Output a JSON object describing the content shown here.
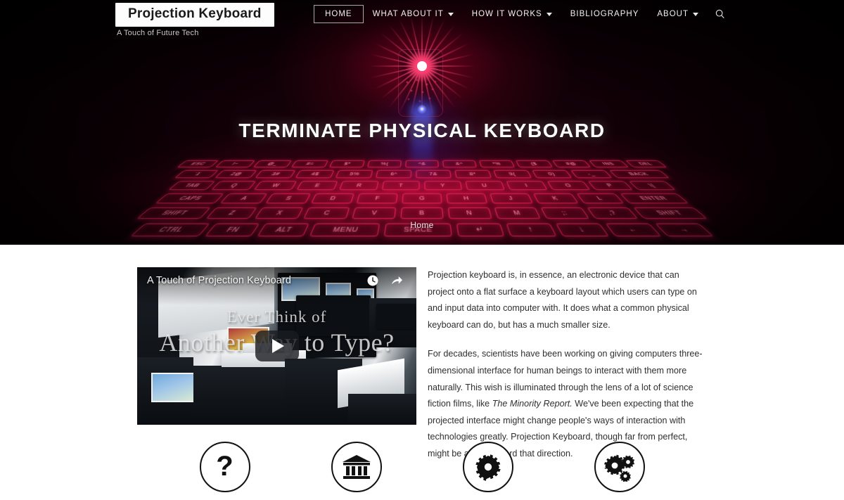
{
  "site": {
    "logo": "Projection Keyboard",
    "tagline": "A Touch of Future Tech"
  },
  "nav": {
    "items": [
      {
        "label": "HOME",
        "active": true,
        "has_dropdown": false
      },
      {
        "label": "WHAT ABOUT IT",
        "active": false,
        "has_dropdown": true
      },
      {
        "label": "HOW IT WORKS",
        "active": false,
        "has_dropdown": true
      },
      {
        "label": "BIBLIOGRAPHY",
        "active": false,
        "has_dropdown": false
      },
      {
        "label": "ABOUT",
        "active": false,
        "has_dropdown": true
      }
    ],
    "search_icon": "search-icon"
  },
  "hero": {
    "title": "TERMINATE PHYSICAL KEYBOARD",
    "breadcrumb": "Home",
    "keyboard_rows": [
      [
        "ESC",
        "!~",
        "@_",
        "#=",
        "$*",
        "%(",
        "^&",
        "&^",
        "*%",
        "($",
        "#@",
        "INS",
        "DEL"
      ],
      [
        "`1",
        "2@",
        "3#",
        "4$",
        "5%",
        "6^",
        "7&",
        "8*",
        "9(",
        "0)",
        "-_",
        "BACK"
      ],
      [
        "TAB",
        "Q",
        "W",
        "E",
        "R",
        "T",
        "Y",
        "U",
        "I",
        "O",
        "P",
        "\\|"
      ],
      [
        "CAPS",
        "A",
        "S",
        "D",
        "F",
        "G",
        "H",
        "J",
        "K",
        "L",
        "ENTER"
      ],
      [
        "SHIFT",
        "Z",
        "X",
        "C",
        "V",
        "B",
        "N",
        "M",
        ";:",
        ",?",
        "SHIFT"
      ],
      [
        "CTRL",
        "FN",
        "ALT",
        "MENU",
        "SPACE",
        "↵",
        "↑",
        "↓",
        "←",
        "→"
      ]
    ]
  },
  "video": {
    "title": "A Touch of Projection Keyboard",
    "overlay_line1": "Ever Think of",
    "overlay_line2": "Another Way to Type?",
    "watch_later_icon": "clock-icon",
    "share_icon": "share-icon",
    "play_icon": "play-icon"
  },
  "article": {
    "paragraph1": "Projection keyboard is, in essence, an electronic device that can project onto a flat surface a keyboard layout which users can type on and input data into computer with. It does what a common physical keyboard can do, but has a much smaller size.",
    "paragraph2_a": "For decades, scientists have been working on giving computers three-dimensional interface for human beings to interact with them more naturally. This wish is illuminated through the lens of a lot of science fiction  films, like ",
    "paragraph2_italic": "The Minority Report.",
    "paragraph2_b": " We've been expecting that the projected interface might change people's ways of interaction with technologies greatly. Projection Keyboard, though far from perfect, might be a step toward that direction."
  },
  "feature_icons": [
    {
      "name": "question-mark-icon",
      "glyph": "?"
    },
    {
      "name": "bank-building-icon",
      "glyph": ""
    },
    {
      "name": "gear-icon",
      "glyph": ""
    },
    {
      "name": "gears-icon",
      "glyph": ""
    }
  ],
  "colors": {
    "hero_background": "#050103",
    "laser_red": "#ff2f6e",
    "laser_blue": "#4a56e0",
    "page_background": "#ffffff",
    "body_text": "#2f2f2f",
    "nav_text": "#f1f1f1"
  }
}
